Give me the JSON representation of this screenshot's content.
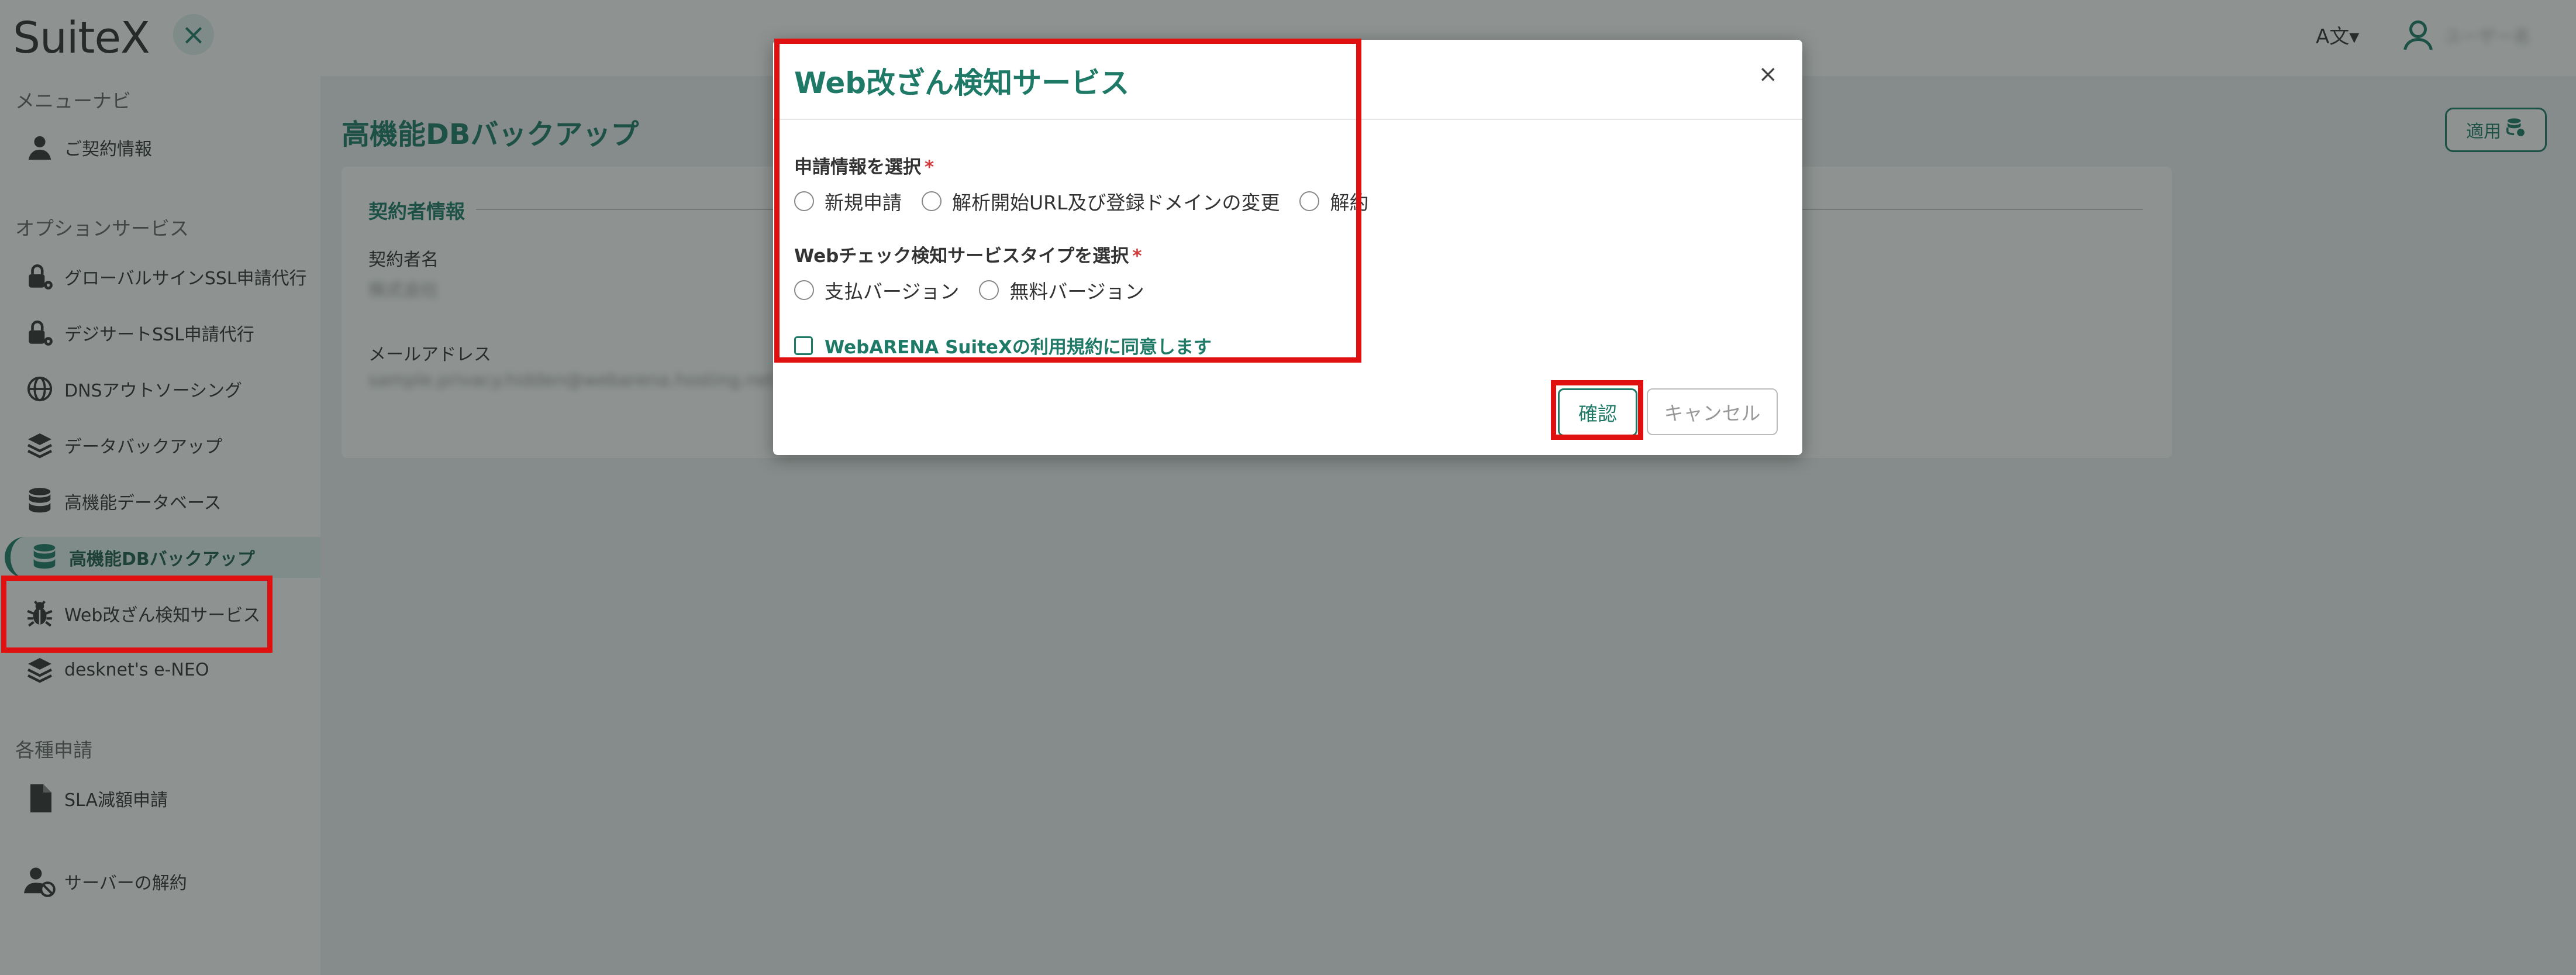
{
  "header": {
    "logo": "SuiteX",
    "close_glyph": "×",
    "lang_glyph": "A文▾",
    "user_name": "ユーザー名"
  },
  "sidebar": {
    "menu_heading": "メニューナビ",
    "contract_item": "ご契約情報",
    "options_heading": "オプションサービス",
    "items": [
      {
        "label": "グローバルサインSSL申請代行",
        "icon": "lock-gear-icon"
      },
      {
        "label": "デジサートSSL申請代行",
        "icon": "lock-gear-icon"
      },
      {
        "label": "DNSアウトソーシング",
        "icon": "globe-icon"
      },
      {
        "label": "データバックアップ",
        "icon": "layers-icon"
      },
      {
        "label": "高機能データベース",
        "icon": "database-icon"
      },
      {
        "label": "高機能DBバックアップ",
        "icon": "database-backup-icon"
      },
      {
        "label": "Web改ざん検知サービス",
        "icon": "bug-icon"
      },
      {
        "label": "desknet's e-NEO",
        "icon": "layers-icon"
      }
    ],
    "requests_heading": "各種申請",
    "sla_item": "SLA減額申請",
    "cancel_server_item": "サーバーの解約"
  },
  "main": {
    "page_title": "高機能DBバックアップ",
    "apply_label": "適用",
    "card_title": "契約者情報",
    "contract_name_label": "契約者名",
    "contract_name_value": "株式会社",
    "email_label": "メールアドレス",
    "email_value": "sample.privacy.hidden@webarena.hosting.net"
  },
  "modal": {
    "title": "Web改ざん検知サービス",
    "close_glyph": "×",
    "section1_label": "申請情報を選択",
    "required_mark": "*",
    "section1_options": [
      "新規申請",
      "解析開始URL及び登録ドメインの変更",
      "解約"
    ],
    "section2_label": "Webチェック検知サービスタイプを選択",
    "section2_options": [
      "支払バージョン",
      "無料バージョン"
    ],
    "agree_label": "WebARENA SuiteXの利用規約に同意します",
    "confirm_label": "確認",
    "cancel_label": "キャンセル"
  },
  "colors": {
    "accent": "#1e7a66",
    "highlight": "#e01010",
    "required": "#d23b3b"
  }
}
